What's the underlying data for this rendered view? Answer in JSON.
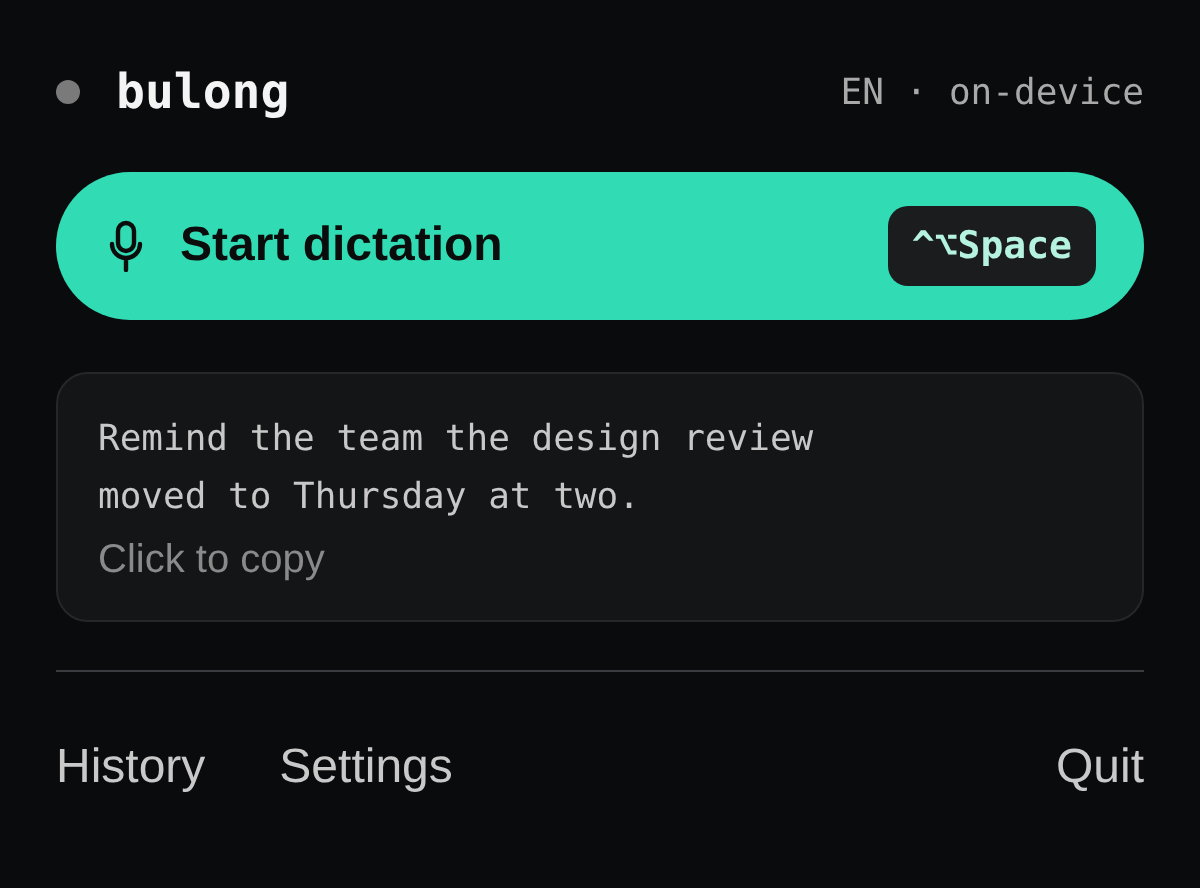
{
  "header": {
    "recording": false,
    "app_name": "bulong",
    "status": "EN · on-device"
  },
  "dictate_button": {
    "label": "Start dictation",
    "shortcut": "^⌥Space"
  },
  "transcript": {
    "text": "Remind the team the design review moved to Thursday at two.",
    "hint": "Click to copy"
  },
  "footer": {
    "left_links": [
      "History",
      "Settings"
    ],
    "right_links": [
      "Quit"
    ]
  }
}
